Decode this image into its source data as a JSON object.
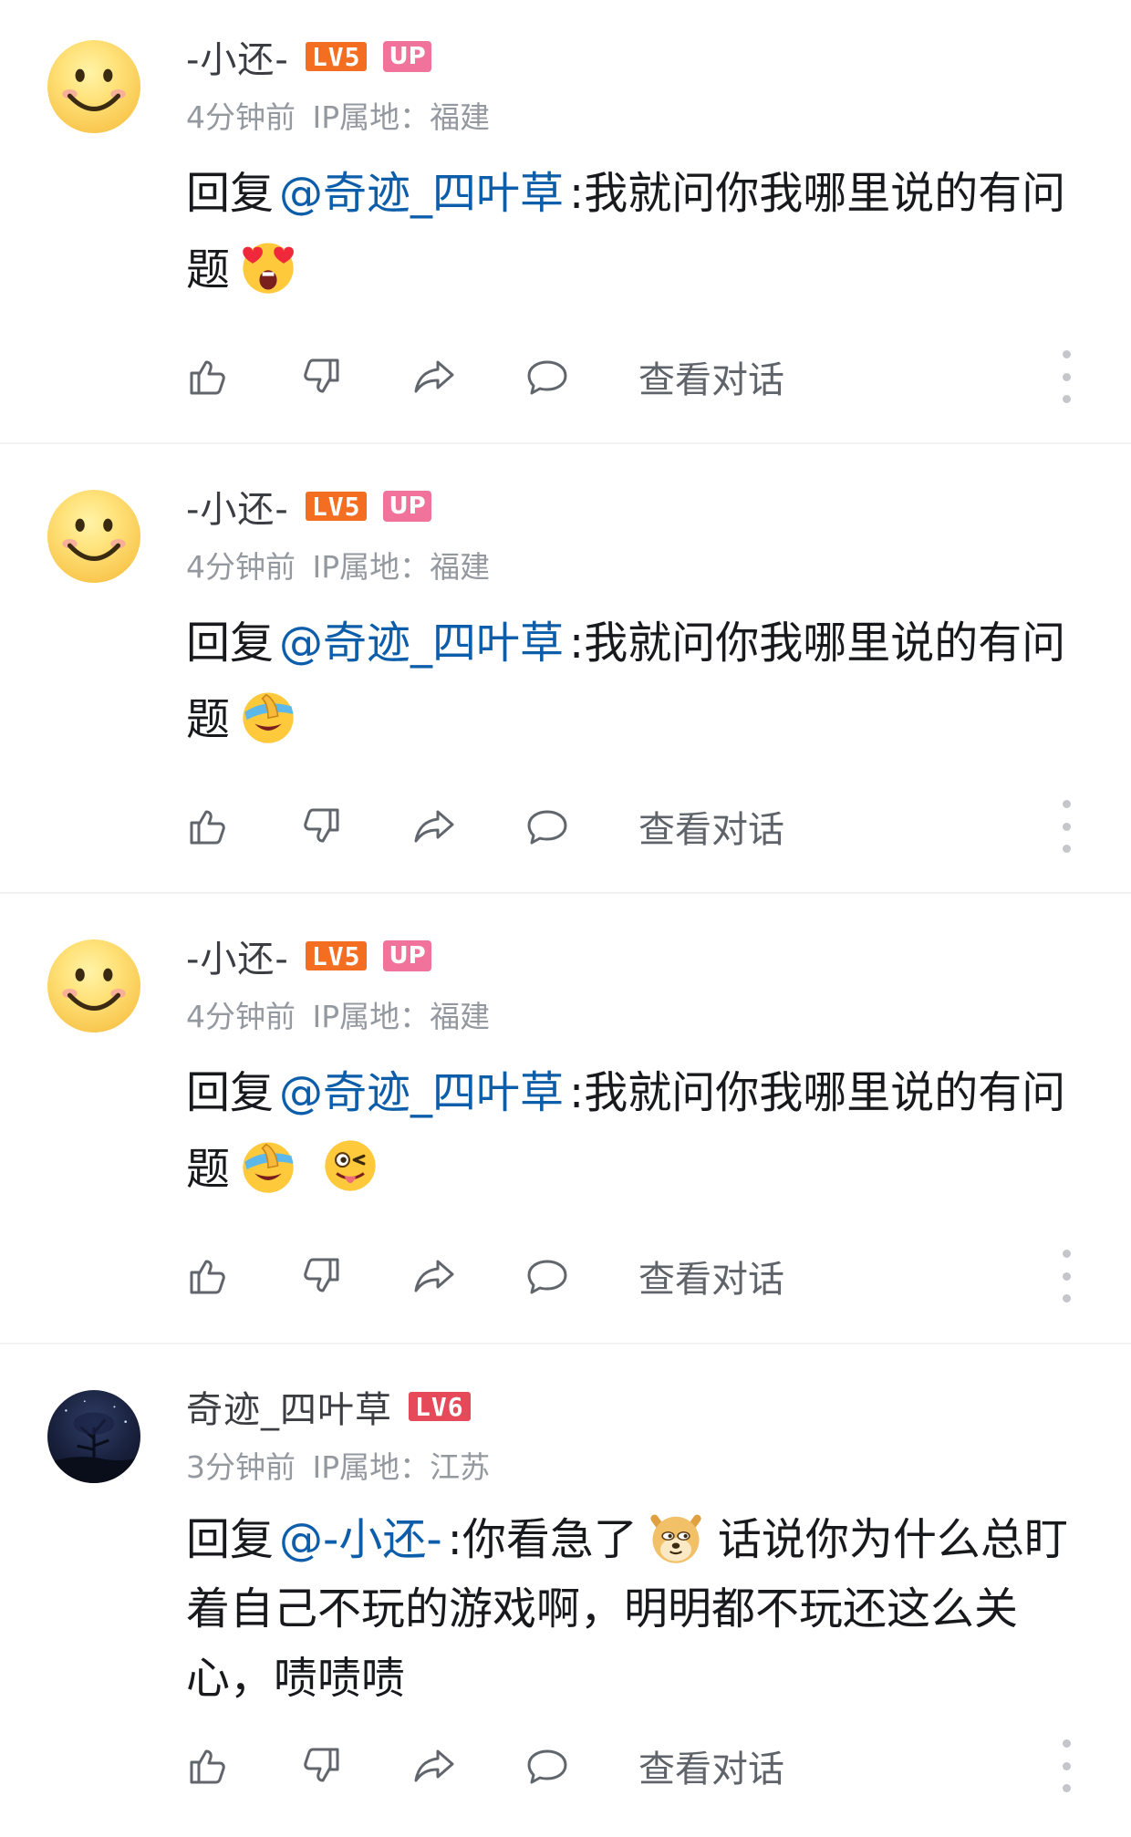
{
  "colors": {
    "mention": "#0d5eaa",
    "meta": "#9499a0",
    "lv5": "#f36e21",
    "lv6": "#e64a5a",
    "up": "#f1729a"
  },
  "comments": [
    {
      "username": "-小还-",
      "level": "LV5",
      "up_badge": "UP",
      "time": "4分钟前",
      "ip": "IP属地：福建",
      "reply_prefix": "回复",
      "mention": "@奇迹_四叶草",
      "text": ":我就问你我哪里说的有问题",
      "emojis": [
        "heart-eyes-emoji"
      ],
      "view_conversation": "查看对话"
    },
    {
      "username": "-小还-",
      "level": "LV5",
      "up_badge": "UP",
      "time": "4分钟前",
      "ip": "IP属地：福建",
      "reply_prefix": "回复",
      "mention": "@奇迹_四叶草",
      "text": ":我就问你我哪里说的有问题",
      "emojis": [
        "facepalm-laugh-emoji"
      ],
      "view_conversation": "查看对话"
    },
    {
      "username": "-小还-",
      "level": "LV5",
      "up_badge": "UP",
      "time": "4分钟前",
      "ip": "IP属地：福建",
      "reply_prefix": "回复",
      "mention": "@奇迹_四叶草",
      "text": ":我就问你我哪里说的有问题",
      "emojis": [
        "facepalm-laugh-emoji",
        "wink-tongue-emoji"
      ],
      "view_conversation": "查看对话"
    },
    {
      "username": "奇迹_四叶草",
      "level": "LV6",
      "time": "3分钟前",
      "ip": "IP属地：江苏",
      "reply_prefix": "回复",
      "mention": "@-小还-",
      "text_a": ":你看急了",
      "text_b": "话说你为什么总盯着自己不玩的游戏啊，明明都不玩还这么关心，啧啧啧",
      "emojis": [
        "doge-emoji"
      ],
      "view_conversation": "查看对话"
    }
  ]
}
